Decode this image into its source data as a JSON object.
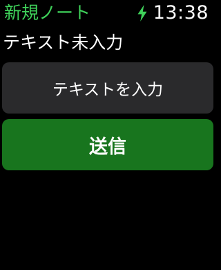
{
  "header": {
    "title": "新規ノート",
    "time": "13:38",
    "charging_icon": "lightning-bolt-icon"
  },
  "status": {
    "text": "テキスト未入力"
  },
  "buttons": {
    "input_label": "テキストを入力",
    "send_label": "送信"
  },
  "colors": {
    "accent_green": "#3fd25a",
    "send_button_bg": "#18751e",
    "input_button_bg": "#2a2a2c",
    "background": "#000000"
  }
}
